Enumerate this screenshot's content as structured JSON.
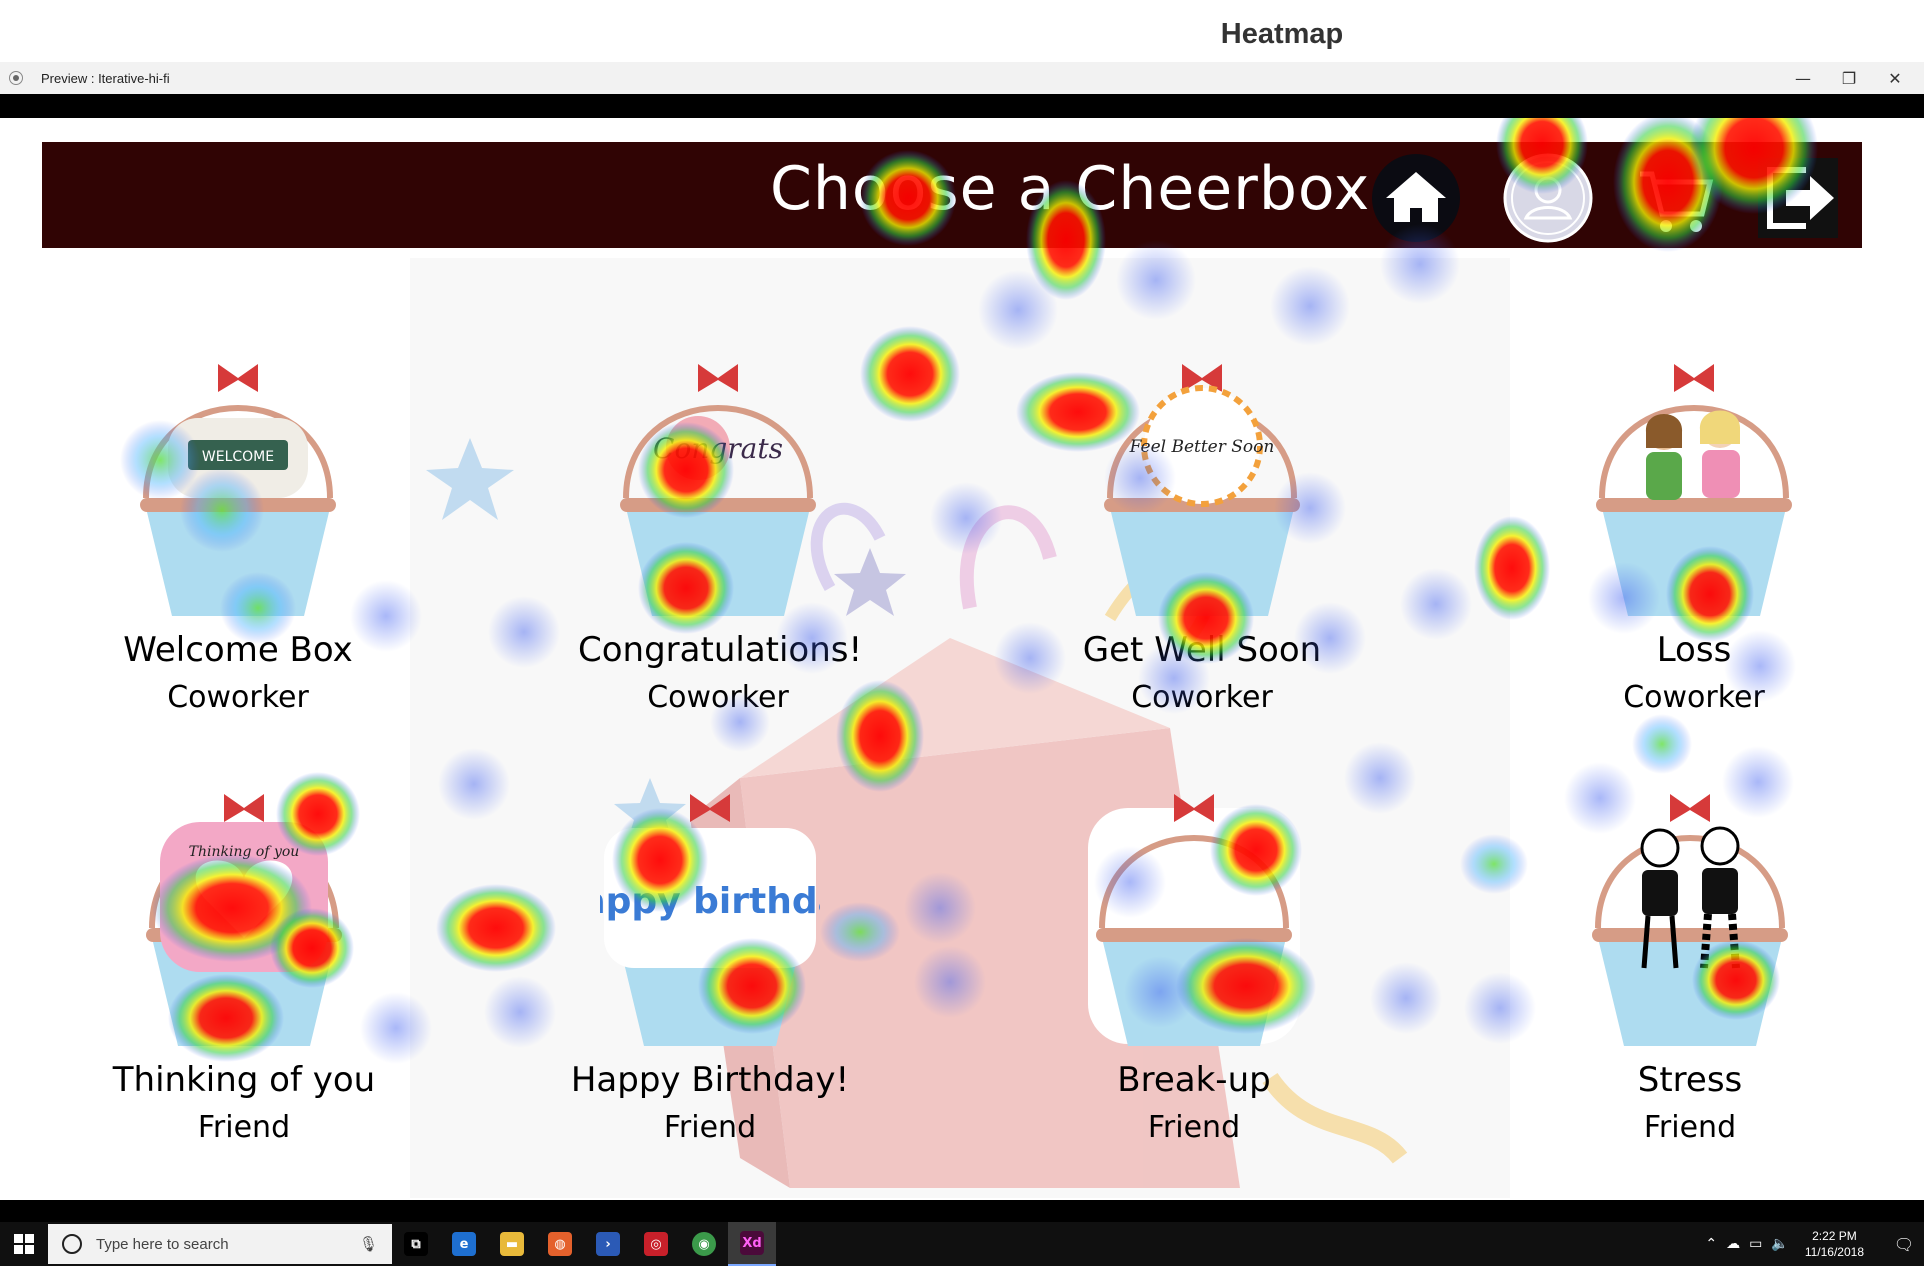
{
  "heatmap_title": "Heatmap",
  "window": {
    "title": "Preview : Iterative-hi-fi",
    "minimize": "—",
    "restore": "❐",
    "close": "✕"
  },
  "header": {
    "title": "Choose a Cheerbox",
    "buttons": [
      {
        "name": "home",
        "icon": "home-icon"
      },
      {
        "name": "profile",
        "icon": "user-icon"
      },
      {
        "name": "cart",
        "icon": "cart-icon"
      },
      {
        "name": "logout",
        "icon": "logout-icon"
      }
    ]
  },
  "cards": [
    {
      "title": "Welcome Box",
      "subtitle": "Coworker",
      "badge": "WELCOME"
    },
    {
      "title": "Congratulations!",
      "subtitle": "Coworker",
      "badge": "Congrats"
    },
    {
      "title": "Get Well Soon",
      "subtitle": "Coworker",
      "badge": "Feel Better Soon"
    },
    {
      "title": "Loss",
      "subtitle": "Coworker",
      "badge": ""
    },
    {
      "title": "Thinking of you",
      "subtitle": "Friend",
      "badge": "Thinking of you"
    },
    {
      "title": "Happy Birthday!",
      "subtitle": "Friend",
      "badge": "happy birthday"
    },
    {
      "title": "Break-up",
      "subtitle": "Friend",
      "badge": ""
    },
    {
      "title": "Stress",
      "subtitle": "Friend",
      "badge": ""
    }
  ],
  "taskbar": {
    "search_placeholder": "Type here to search",
    "apps": [
      {
        "name": "task-view",
        "color": "#000000",
        "label": "⧉"
      },
      {
        "name": "edge",
        "color": "#1e6fd0",
        "label": "e"
      },
      {
        "name": "file-explorer",
        "color": "#e8b93a",
        "label": "▬"
      },
      {
        "name": "app-orange",
        "color": "#e4612c",
        "label": "◍"
      },
      {
        "name": "powershell",
        "color": "#2b5ab6",
        "label": "›"
      },
      {
        "name": "app-red",
        "color": "#c8202a",
        "label": "◎"
      },
      {
        "name": "chrome",
        "color": "#3b9a4a",
        "label": "◉"
      },
      {
        "name": "adobe-xd",
        "color": "#4b0a3a",
        "label": "Xd"
      }
    ],
    "time": "2:22 PM",
    "date": "11/16/2018"
  },
  "colors": {
    "header_bg": "#300404",
    "basket_blue": "#aedcf0",
    "basket_rim": "#d69c86",
    "bow_red": "#d63a3a"
  }
}
